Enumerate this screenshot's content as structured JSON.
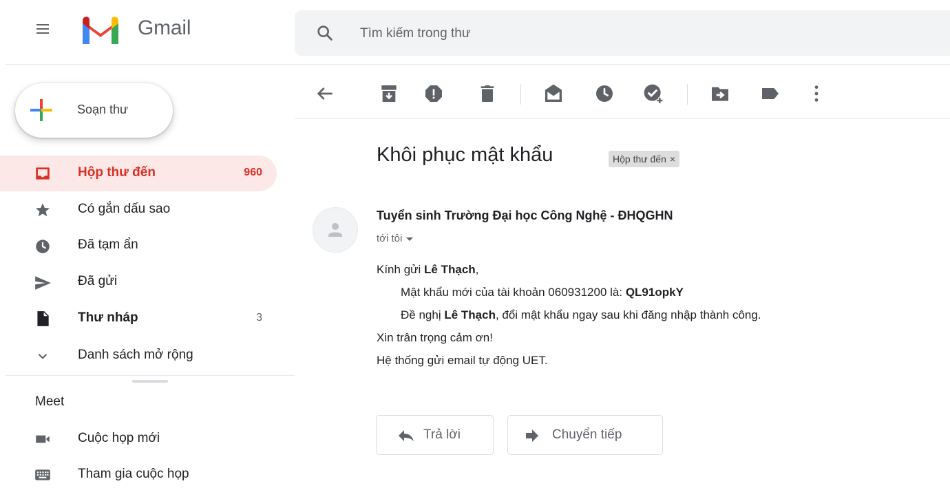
{
  "app": {
    "name": "Gmail"
  },
  "search": {
    "placeholder": "Tìm kiếm trong thư"
  },
  "compose": {
    "label": "Soạn thư"
  },
  "sidebar": {
    "items": [
      {
        "label": "Hộp thư đến",
        "count": "960",
        "icon": "inbox-icon"
      },
      {
        "label": "Có gắn dấu sao",
        "count": "",
        "icon": "star-icon"
      },
      {
        "label": "Đã tạm ẩn",
        "count": "",
        "icon": "clock-icon"
      },
      {
        "label": "Đã gửi",
        "count": "",
        "icon": "send-icon"
      },
      {
        "label": "Thư nháp",
        "count": "3",
        "icon": "draft-icon"
      },
      {
        "label": "Danh sách mở rộng",
        "count": "",
        "icon": "chevron-down-icon"
      }
    ]
  },
  "meet": {
    "heading": "Meet",
    "items": [
      {
        "label": "Cuộc họp mới",
        "icon": "video-camera-icon"
      },
      {
        "label": "Tham gia cuộc họp",
        "icon": "keyboard-icon"
      }
    ]
  },
  "toolbar": {
    "icons": [
      "back-arrow-icon",
      "archive-icon",
      "report-spam-icon",
      "delete-icon",
      "mark-unread-icon",
      "snooze-icon",
      "add-to-tasks-icon",
      "move-to-icon",
      "label-icon",
      "more-options-icon"
    ]
  },
  "message": {
    "subject": "Khôi phục mật khẩu",
    "label_chip": "Hộp thư đến",
    "label_chip_close": "×",
    "sender": "Tuyển sinh Trường Đại học Công Nghệ - ĐHQGHN",
    "recipient": "tới tôi",
    "greeting_prefix": "Kính gửi ",
    "greeting_name": "Lê Thạch",
    "greeting_suffix": ",",
    "line1_prefix": "Mật khẩu mới của tài khoản 060931200 là: ",
    "line1_password": "QL91opkY",
    "line2_prefix": "Đề nghị ",
    "line2_name": "Lê Thạch",
    "line2_suffix": ", đổi mật khẩu ngay sau khi đăng nhập thành công.",
    "closing": "Xin trân trọng cảm ơn!",
    "signature": "Hệ thống gửi email tự động UET."
  },
  "actions": {
    "reply": "Trả lời",
    "forward": "Chuyển tiếp"
  },
  "colors": {
    "accent_red": "#d93025",
    "active_bg": "#fce8e6",
    "icon_gray": "#5f6368"
  }
}
